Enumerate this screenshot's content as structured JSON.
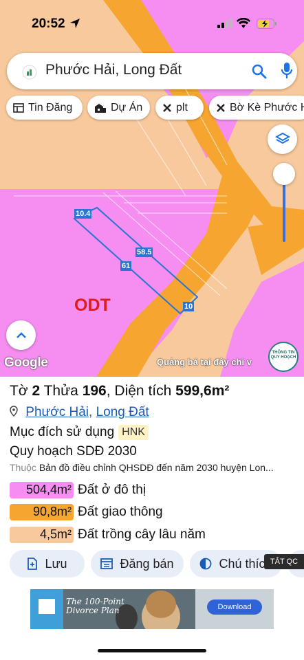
{
  "status_bar": {
    "time": "20:52"
  },
  "search": {
    "query": "Phước Hải, Long Đất"
  },
  "chips": [
    {
      "label": "Tin Đăng",
      "icon": "table-icon"
    },
    {
      "label": "Dự Án",
      "icon": "buildings-icon"
    },
    {
      "label": "plt",
      "icon": "close-icon"
    },
    {
      "label": "Bờ Kè Phước H",
      "icon": "close-icon"
    }
  ],
  "map": {
    "zone_label": "ODT",
    "dimensions": {
      "top": "10.4",
      "right_side": "58.5",
      "left_side": "61",
      "bottom": "10"
    },
    "google_label": "Google",
    "ad_text": "Quảng bá tại đây chi v",
    "badge_text": [
      "THÔNG TIN",
      "QUY HOẠCH"
    ]
  },
  "parcel": {
    "sheet_prefix": "Tờ",
    "sheet": "2",
    "lot_prefix": "Thửa",
    "lot": "196",
    "area_prefix": ", Diện tích",
    "area": "599,6m²",
    "ward": "Phước Hải",
    "district": "Long Đất",
    "purpose_label": "Mục đích sử dụng",
    "purpose_code": "HNK",
    "plan_label": "Quy hoạch SDĐ 2030",
    "doc_prefix": "Thuộc",
    "doc_text": "Bản đồ điều chỉnh QHSDĐ đến năm 2030 huyện Lon..."
  },
  "land_uses": [
    {
      "area": "504,4m²",
      "label": "Đất ở đô thị",
      "color": "#f58ef0"
    },
    {
      "area": "90,8m²",
      "label": "Đất giao thông",
      "color": "#f7a531"
    },
    {
      "area": "4,5m²",
      "label": "Đất trồng cây lâu năm",
      "color": "#f8c99c"
    }
  ],
  "actions": {
    "save": "Lưu",
    "sell": "Đăng bán",
    "legend": "Chú thích"
  },
  "ad_corner": "TẮT QC",
  "ad_banner": {
    "title_line1": "The 100-Point",
    "title_line2": "Divorce Plan",
    "cta": "Download"
  },
  "colors": {
    "residential": "#f58ef0",
    "road": "#f7a531",
    "perennial": "#f8c99c",
    "accent": "#1a5bb8"
  }
}
